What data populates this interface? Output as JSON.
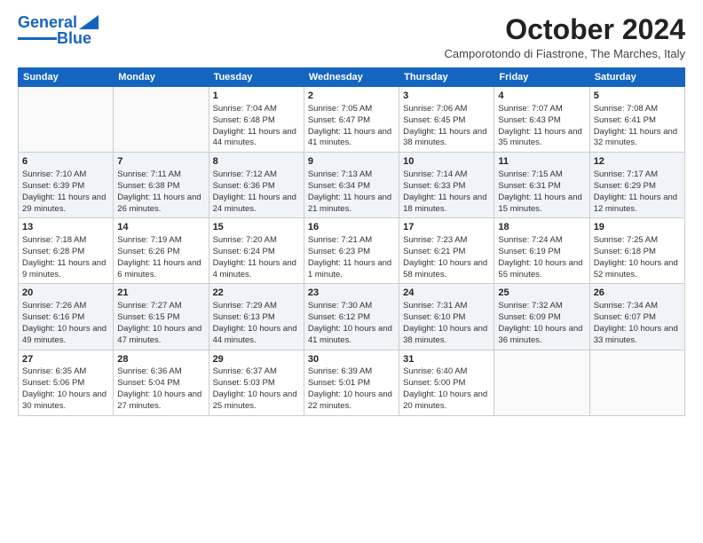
{
  "logo": {
    "line1": "General",
    "line2": "Blue"
  },
  "title": "October 2024",
  "subtitle": "Camporotondo di Fiastrone, The Marches, Italy",
  "days_of_week": [
    "Sunday",
    "Monday",
    "Tuesday",
    "Wednesday",
    "Thursday",
    "Friday",
    "Saturday"
  ],
  "weeks": [
    [
      {
        "day": "",
        "info": ""
      },
      {
        "day": "",
        "info": ""
      },
      {
        "day": "1",
        "info": "Sunrise: 7:04 AM\nSunset: 6:48 PM\nDaylight: 11 hours and 44 minutes."
      },
      {
        "day": "2",
        "info": "Sunrise: 7:05 AM\nSunset: 6:47 PM\nDaylight: 11 hours and 41 minutes."
      },
      {
        "day": "3",
        "info": "Sunrise: 7:06 AM\nSunset: 6:45 PM\nDaylight: 11 hours and 38 minutes."
      },
      {
        "day": "4",
        "info": "Sunrise: 7:07 AM\nSunset: 6:43 PM\nDaylight: 11 hours and 35 minutes."
      },
      {
        "day": "5",
        "info": "Sunrise: 7:08 AM\nSunset: 6:41 PM\nDaylight: 11 hours and 32 minutes."
      }
    ],
    [
      {
        "day": "6",
        "info": "Sunrise: 7:10 AM\nSunset: 6:39 PM\nDaylight: 11 hours and 29 minutes."
      },
      {
        "day": "7",
        "info": "Sunrise: 7:11 AM\nSunset: 6:38 PM\nDaylight: 11 hours and 26 minutes."
      },
      {
        "day": "8",
        "info": "Sunrise: 7:12 AM\nSunset: 6:36 PM\nDaylight: 11 hours and 24 minutes."
      },
      {
        "day": "9",
        "info": "Sunrise: 7:13 AM\nSunset: 6:34 PM\nDaylight: 11 hours and 21 minutes."
      },
      {
        "day": "10",
        "info": "Sunrise: 7:14 AM\nSunset: 6:33 PM\nDaylight: 11 hours and 18 minutes."
      },
      {
        "day": "11",
        "info": "Sunrise: 7:15 AM\nSunset: 6:31 PM\nDaylight: 11 hours and 15 minutes."
      },
      {
        "day": "12",
        "info": "Sunrise: 7:17 AM\nSunset: 6:29 PM\nDaylight: 11 hours and 12 minutes."
      }
    ],
    [
      {
        "day": "13",
        "info": "Sunrise: 7:18 AM\nSunset: 6:28 PM\nDaylight: 11 hours and 9 minutes."
      },
      {
        "day": "14",
        "info": "Sunrise: 7:19 AM\nSunset: 6:26 PM\nDaylight: 11 hours and 6 minutes."
      },
      {
        "day": "15",
        "info": "Sunrise: 7:20 AM\nSunset: 6:24 PM\nDaylight: 11 hours and 4 minutes."
      },
      {
        "day": "16",
        "info": "Sunrise: 7:21 AM\nSunset: 6:23 PM\nDaylight: 11 hours and 1 minute."
      },
      {
        "day": "17",
        "info": "Sunrise: 7:23 AM\nSunset: 6:21 PM\nDaylight: 10 hours and 58 minutes."
      },
      {
        "day": "18",
        "info": "Sunrise: 7:24 AM\nSunset: 6:19 PM\nDaylight: 10 hours and 55 minutes."
      },
      {
        "day": "19",
        "info": "Sunrise: 7:25 AM\nSunset: 6:18 PM\nDaylight: 10 hours and 52 minutes."
      }
    ],
    [
      {
        "day": "20",
        "info": "Sunrise: 7:26 AM\nSunset: 6:16 PM\nDaylight: 10 hours and 49 minutes."
      },
      {
        "day": "21",
        "info": "Sunrise: 7:27 AM\nSunset: 6:15 PM\nDaylight: 10 hours and 47 minutes."
      },
      {
        "day": "22",
        "info": "Sunrise: 7:29 AM\nSunset: 6:13 PM\nDaylight: 10 hours and 44 minutes."
      },
      {
        "day": "23",
        "info": "Sunrise: 7:30 AM\nSunset: 6:12 PM\nDaylight: 10 hours and 41 minutes."
      },
      {
        "day": "24",
        "info": "Sunrise: 7:31 AM\nSunset: 6:10 PM\nDaylight: 10 hours and 38 minutes."
      },
      {
        "day": "25",
        "info": "Sunrise: 7:32 AM\nSunset: 6:09 PM\nDaylight: 10 hours and 36 minutes."
      },
      {
        "day": "26",
        "info": "Sunrise: 7:34 AM\nSunset: 6:07 PM\nDaylight: 10 hours and 33 minutes."
      }
    ],
    [
      {
        "day": "27",
        "info": "Sunrise: 6:35 AM\nSunset: 5:06 PM\nDaylight: 10 hours and 30 minutes."
      },
      {
        "day": "28",
        "info": "Sunrise: 6:36 AM\nSunset: 5:04 PM\nDaylight: 10 hours and 27 minutes."
      },
      {
        "day": "29",
        "info": "Sunrise: 6:37 AM\nSunset: 5:03 PM\nDaylight: 10 hours and 25 minutes."
      },
      {
        "day": "30",
        "info": "Sunrise: 6:39 AM\nSunset: 5:01 PM\nDaylight: 10 hours and 22 minutes."
      },
      {
        "day": "31",
        "info": "Sunrise: 6:40 AM\nSunset: 5:00 PM\nDaylight: 10 hours and 20 minutes."
      },
      {
        "day": "",
        "info": ""
      },
      {
        "day": "",
        "info": ""
      }
    ]
  ]
}
